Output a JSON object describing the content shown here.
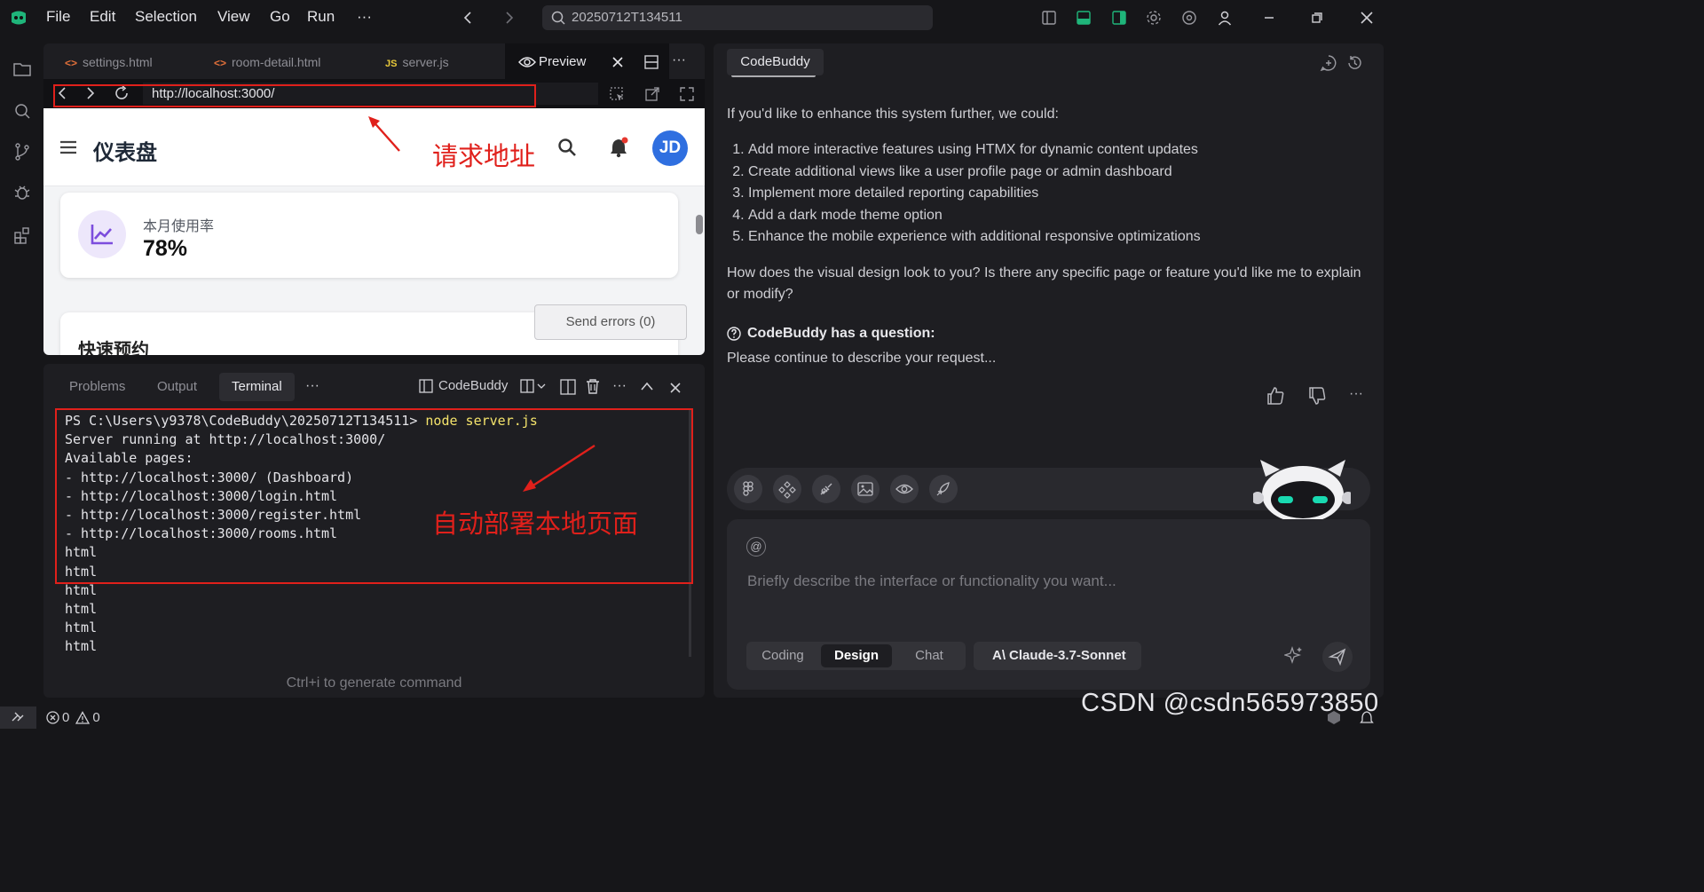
{
  "titlebar": {
    "menu": [
      "File",
      "Edit",
      "Selection",
      "View",
      "Go",
      "Run",
      "···"
    ],
    "search_value": "20250712T134511"
  },
  "editor": {
    "tabs": [
      {
        "label": "settings.html",
        "icon": "html-icon"
      },
      {
        "label": "room-detail.html",
        "icon": "html-icon"
      },
      {
        "label": "server.js",
        "icon": "js-icon",
        "badge": "JS"
      },
      {
        "label": "Preview",
        "icon": "eye-icon",
        "active": true
      }
    ],
    "url": "http://localhost:3000/"
  },
  "preview": {
    "page_title": "仪表盘",
    "avatar_initials": "JD",
    "stat_label": "本月使用率",
    "stat_value": "78%",
    "stat_progress_percent": 78,
    "quick_title": "快速预约",
    "send_errors": "Send errors (0)"
  },
  "annotations": {
    "url_label": "请求地址",
    "terminal_label": "自动部署本地页面",
    "color": "#e0201b"
  },
  "panel": {
    "tabs": [
      "Problems",
      "Output",
      "Terminal"
    ],
    "more": "···",
    "codebuddy_label": "CodeBuddy",
    "prompt": "PS C:\\Users\\y9378\\CodeBuddy\\20250712T134511> ",
    "command": "node server.js",
    "output": [
      "Server running at http://localhost:3000/",
      "Available pages:",
      "- http://localhost:3000/ (Dashboard)",
      "- http://localhost:3000/login.html",
      "- http://localhost:3000/register.html",
      "- http://localhost:3000/rooms.html",
      "html",
      "html",
      "html",
      "html",
      "html",
      "html"
    ],
    "hint": "Ctrl+i to generate command"
  },
  "chat": {
    "tab": "CodeBuddy",
    "intro": "If you'd like to enhance this system further, we could:",
    "items": [
      "Add more interactive features using HTMX for dynamic content updates",
      "Create additional views like a user profile page or admin dashboard",
      "Implement more detailed reporting capabilities",
      "Add a dark mode theme option",
      "Enhance the mobile experience with additional responsive optimizations"
    ],
    "followup": "How does the visual design look to you? Is there any specific page or feature you'd like me to explain or modify?",
    "question_title": "CodeBuddy has a question:",
    "question_text": "Please continue to describe your request...",
    "at_symbol": "@",
    "input_placeholder": "Briefly describe the interface or functionality you want...",
    "modes": [
      "Coding",
      "Design",
      "Chat"
    ],
    "active_mode": "Design",
    "model": "Claude-3.7-Sonnet",
    "model_logo": "A\\"
  },
  "status": {
    "errors": "0",
    "warnings": "0"
  },
  "watermark": "CSDN @csdn565973850"
}
